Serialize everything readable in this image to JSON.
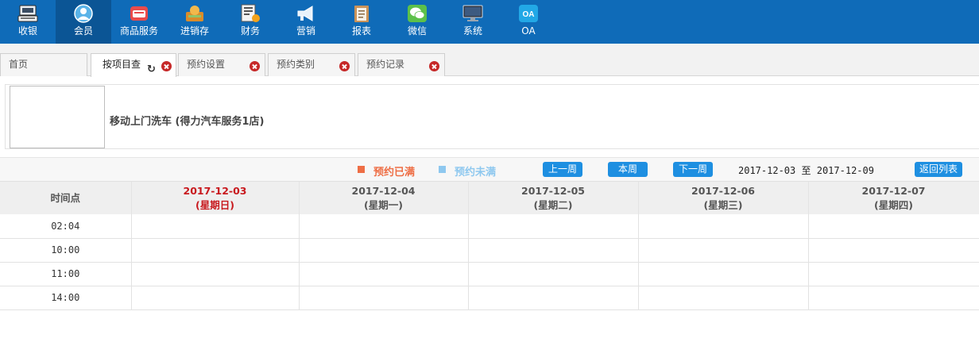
{
  "nav": {
    "items": [
      {
        "label": "收银",
        "icon": "cash-register-icon"
      },
      {
        "label": "会员",
        "icon": "member-icon",
        "active": true
      },
      {
        "label": "商品服务",
        "icon": "goods-service-icon"
      },
      {
        "label": "进销存",
        "icon": "inventory-icon"
      },
      {
        "label": "财务",
        "icon": "finance-icon"
      },
      {
        "label": "营销",
        "icon": "megaphone-icon"
      },
      {
        "label": "报表",
        "icon": "report-icon"
      },
      {
        "label": "微信",
        "icon": "wechat-icon"
      },
      {
        "label": "系统",
        "icon": "monitor-icon"
      },
      {
        "label": "OA",
        "icon": "oa-icon"
      }
    ]
  },
  "tabs": [
    {
      "label": "首页"
    },
    {
      "label": "按项目查"
    },
    {
      "label": "预约设置"
    },
    {
      "label": "预约类别"
    },
    {
      "label": "预约记录"
    }
  ],
  "service": {
    "name": "移动上门洗车 (得力汽车服务1店)"
  },
  "legend": {
    "full": {
      "label": "预约已满",
      "color": "#ee6e45"
    },
    "available": {
      "label": "预约未满",
      "color": "#8ec8ef"
    }
  },
  "toolbar": {
    "prev_week": "上一周",
    "this_week": "本周",
    "next_week": "下一周",
    "range_start": "2017-12-03",
    "range_sep": "至",
    "range_end": "2017-12-09",
    "back_to_list": "返回列表"
  },
  "schedule": {
    "time_header": "时间点",
    "days": [
      {
        "date": "2017-12-03",
        "weekday": "(星期日)",
        "today": true
      },
      {
        "date": "2017-12-04",
        "weekday": "(星期一)"
      },
      {
        "date": "2017-12-05",
        "weekday": "(星期二)"
      },
      {
        "date": "2017-12-06",
        "weekday": "(星期三)"
      },
      {
        "date": "2017-12-07",
        "weekday": "(星期四)"
      }
    ],
    "times": [
      "02:04",
      "10:00",
      "11:00",
      "14:00"
    ]
  },
  "colors": {
    "nav_bg": "#0f6bb8",
    "today": "#c8191e",
    "button": "#1e8fe1"
  }
}
